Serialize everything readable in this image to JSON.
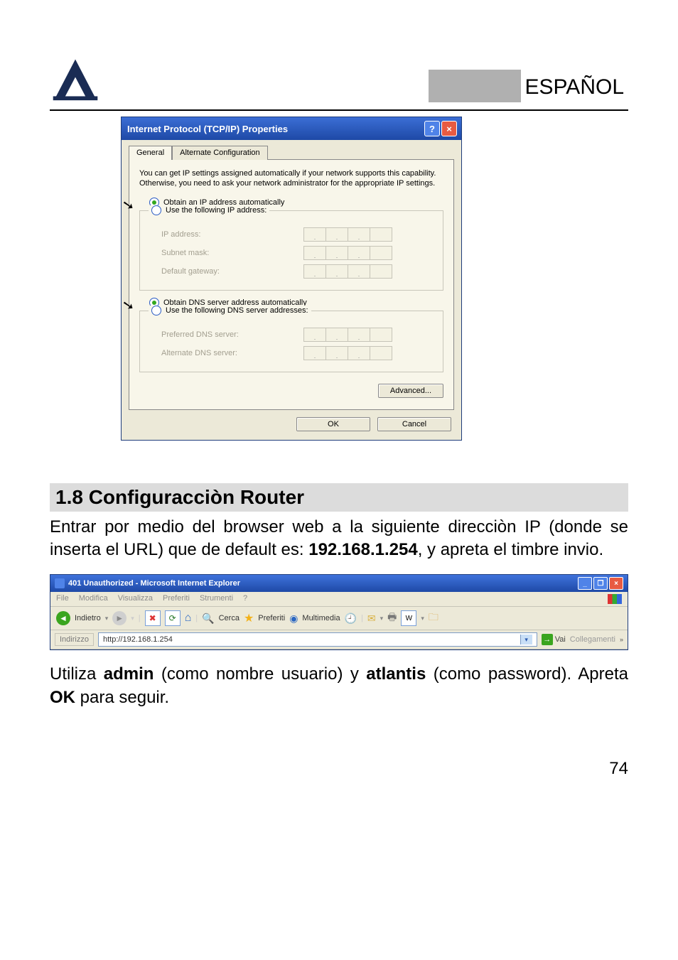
{
  "header": {
    "language": "ESPAÑOL"
  },
  "dialog": {
    "title": "Internet Protocol (TCP/IP) Properties",
    "tabs": {
      "general": "General",
      "alt": "Alternate Configuration"
    },
    "help_text": "You can get IP settings assigned automatically if your network supports this capability. Otherwise, you need to ask your network administrator for the appropriate IP settings.",
    "ip_auto": "Obtain an IP address automatically",
    "ip_manual": "Use the following IP address:",
    "ip_field": "IP address:",
    "mask_field": "Subnet mask:",
    "gw_field": "Default gateway:",
    "dns_auto": "Obtain DNS server address automatically",
    "dns_manual": "Use the following DNS server addresses:",
    "pref_dns": "Preferred DNS server:",
    "alt_dns": "Alternate DNS server:",
    "advanced": "Advanced...",
    "ok": "OK",
    "cancel": "Cancel"
  },
  "section": {
    "heading": "1.8 Configuracciòn Router",
    "para1_a": "Entrar por medio del browser web a la siguiente direcciòn IP (donde se inserta el URL) que de default es: ",
    "para1_ip": "192.168.1.254",
    "para1_b": ", y apreta el timbre  invio.",
    "para2_a": "Utiliza ",
    "para2_user": "admin",
    "para2_b": " (como nombre usuario) y ",
    "para2_pass": "atlantis",
    "para2_c": " (como password). Apreta ",
    "para2_ok": "OK",
    "para2_d": " para seguir."
  },
  "ie": {
    "title": "401 Unauthorized - Microsoft Internet Explorer",
    "menu": {
      "file": "File",
      "modifica": "Modifica",
      "visualizza": "Visualizza",
      "preferiti": "Preferiti",
      "strumenti": "Strumenti",
      "help": "?"
    },
    "toolbar": {
      "indietro": "Indietro",
      "cerca": "Cerca",
      "preferiti": "Preferiti",
      "multimedia": "Multimedia"
    },
    "addr_label": "Indirizzo",
    "url": "http://192.168.1.254",
    "vai": "Vai",
    "collegamenti": "Collegamenti"
  },
  "page_number": "74"
}
